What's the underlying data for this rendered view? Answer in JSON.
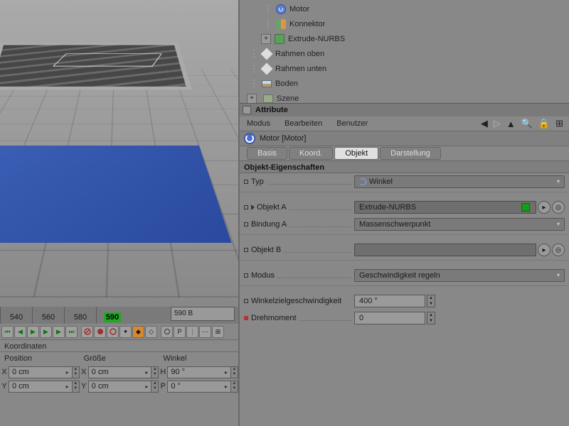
{
  "tree": {
    "items": [
      {
        "label": "Motor",
        "icon": "motor",
        "indent": 2
      },
      {
        "label": "Konnektor",
        "icon": "konn",
        "indent": 2
      },
      {
        "label": "Extrude-NURBS",
        "icon": "nurbs",
        "indent": 2,
        "expand": "+",
        "materials": [
          "grey",
          "brown",
          "grey"
        ]
      },
      {
        "label": "Rahmen oben",
        "icon": "null",
        "indent": 1,
        "materials": [
          "grey",
          "brown",
          "grey"
        ]
      },
      {
        "label": "Rahmen unten",
        "icon": "null",
        "indent": 1,
        "materials": [
          "grey",
          "brown",
          "grey"
        ]
      },
      {
        "label": "Boden",
        "icon": "floor",
        "indent": 1,
        "materials": [
          "blue",
          "grey",
          "grey"
        ]
      },
      {
        "label": "Szene",
        "icon": "scene",
        "indent": 0,
        "expand": "+"
      }
    ]
  },
  "timeline": {
    "ticks": [
      "540",
      "560",
      "580",
      "590"
    ],
    "current": "590",
    "field": "590 B"
  },
  "coord": {
    "title": "Koordinaten",
    "cols": [
      "Position",
      "Größe",
      "Winkel"
    ],
    "rows": [
      {
        "a": "X",
        "v1": "0 cm",
        "a2": "X",
        "v2": "0 cm",
        "a3": "H",
        "v3": "90 °"
      },
      {
        "a": "Y",
        "v1": "0 cm",
        "a2": "Y",
        "v2": "0 cm",
        "a3": "P",
        "v3": "0 °"
      }
    ]
  },
  "attr": {
    "title": "Attribute",
    "menu": [
      "Modus",
      "Bearbeiten",
      "Benutzer"
    ],
    "object": "Motor [Motor]",
    "tabs": [
      "Basis",
      "Koord.",
      "Objekt",
      "Darstellung"
    ],
    "section": "Objekt-Eigenschaften",
    "typ_label": "Typ",
    "typ_value": "Winkel",
    "objA_label": "Objekt A",
    "objA_value": "Extrude-NURBS",
    "bindA_label": "Bindung A",
    "bindA_value": "Massenschwerpunkt",
    "objB_label": "Objekt B",
    "objB_value": "",
    "modus_label": "Modus",
    "modus_value": "Geschwindigkeit regeln",
    "winkel_label": "Winkelzielgeschwindigkeit",
    "winkel_value": "400 °",
    "dreh_label": "Drehmoment",
    "dreh_value": "0"
  }
}
